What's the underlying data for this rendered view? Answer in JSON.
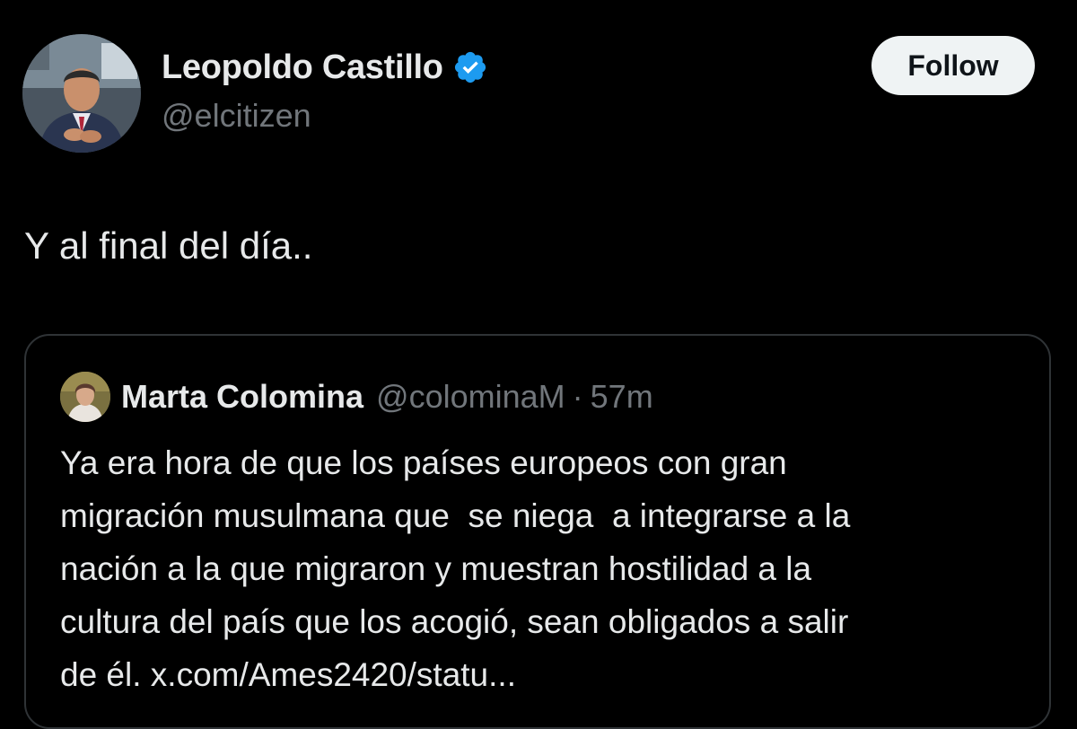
{
  "author": {
    "display_name": "Leopoldo Castillo",
    "handle": "@elcitizen",
    "verified_icon": "verified-badge-icon",
    "verified_color": "#1d9bf0"
  },
  "follow_button": {
    "label": "Follow"
  },
  "tweet": {
    "text": "Y al final del día.."
  },
  "quoted_tweet": {
    "display_name": "Marta Colomina",
    "handle": "@colominaM",
    "separator": "·",
    "time": "57m",
    "lines": [
      "Ya era hora de que los países europeos con gran",
      "migración musulmana que  se niega  a integrarse a la",
      "nación a la que migraron y muestran hostilidad a la",
      "cultura del país que los acogió, sean obligados a salir",
      "de él. x.com/Ames2420/statu..."
    ]
  },
  "colors": {
    "background": "#000000",
    "primary_text": "#e7e9ea",
    "secondary_text": "#71767b",
    "border": "#2f3336",
    "follow_bg": "#eff3f4"
  }
}
